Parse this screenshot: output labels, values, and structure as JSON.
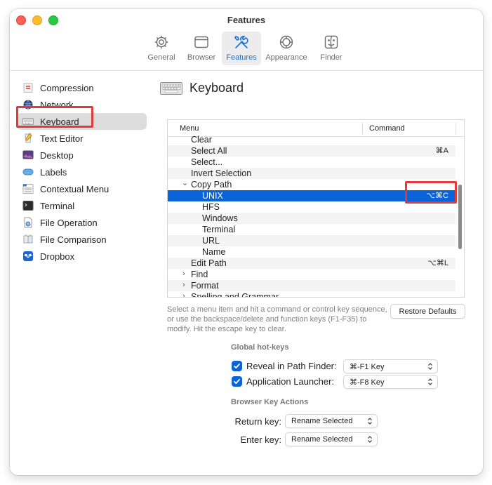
{
  "window": {
    "title": "Features"
  },
  "toolbar": {
    "items": [
      {
        "label": "General",
        "icon": "gear-icon"
      },
      {
        "label": "Browser",
        "icon": "browser-window-icon"
      },
      {
        "label": "Features",
        "icon": "tools-icon",
        "active": true
      },
      {
        "label": "Appearance",
        "icon": "appearance-icon"
      },
      {
        "label": "Finder",
        "icon": "finder-icon"
      }
    ]
  },
  "sidebar": {
    "items": [
      {
        "label": "Compression"
      },
      {
        "label": "Network"
      },
      {
        "label": "Keyboard",
        "selected": true
      },
      {
        "label": "Text Editor"
      },
      {
        "label": "Desktop"
      },
      {
        "label": "Labels"
      },
      {
        "label": "Contextual Menu"
      },
      {
        "label": "Terminal"
      },
      {
        "label": "File Operation"
      },
      {
        "label": "File Comparison"
      },
      {
        "label": "Dropbox"
      }
    ]
  },
  "pane": {
    "title": "Keyboard"
  },
  "table": {
    "columns": {
      "menu": "Menu",
      "command": "Command"
    },
    "rows": [
      {
        "label": "Clear",
        "command": ""
      },
      {
        "label": "Select All",
        "command": "⌘A"
      },
      {
        "label": "Select...",
        "command": ""
      },
      {
        "label": "Invert Selection",
        "command": ""
      },
      {
        "label": "Copy Path",
        "command": "",
        "chevron": "⌄"
      },
      {
        "label": "UNIX",
        "command": "⌥⌘C"
      },
      {
        "label": "HFS",
        "command": ""
      },
      {
        "label": "Windows",
        "command": ""
      },
      {
        "label": "Terminal",
        "command": ""
      },
      {
        "label": "URL",
        "command": ""
      },
      {
        "label": "Name",
        "command": ""
      },
      {
        "label": "Edit Path",
        "command": "⌥⌘L"
      },
      {
        "label": "Find",
        "command": "",
        "chevron": "›"
      },
      {
        "label": "Format",
        "command": "",
        "chevron": "›"
      },
      {
        "label": "Spelling and Grammar",
        "command": "",
        "chevron": "›"
      }
    ]
  },
  "help_text": "Select a menu item and hit a command or control key sequence, or use the backspace/delete and function keys (F1-F35) to modify. Hit the escape key to clear.",
  "restore_defaults": "Restore Defaults",
  "global_hotkeys": {
    "title": "Global hot-keys",
    "items": [
      {
        "label": "Reveal in Path Finder:",
        "value": "⌘-F1 Key",
        "checked": true
      },
      {
        "label": "Application Launcher:",
        "value": "⌘-F8 Key",
        "checked": true
      }
    ]
  },
  "browser_keys": {
    "title": "Browser Key Actions",
    "items": [
      {
        "label": "Return key:",
        "value": "Rename Selected"
      },
      {
        "label": "Enter key:",
        "value": "Rename Selected"
      }
    ]
  },
  "colors": {
    "accent": "#0a63d9",
    "highlight_box": "#e03a3a",
    "sidebar_selected": "#dcdcdc"
  }
}
